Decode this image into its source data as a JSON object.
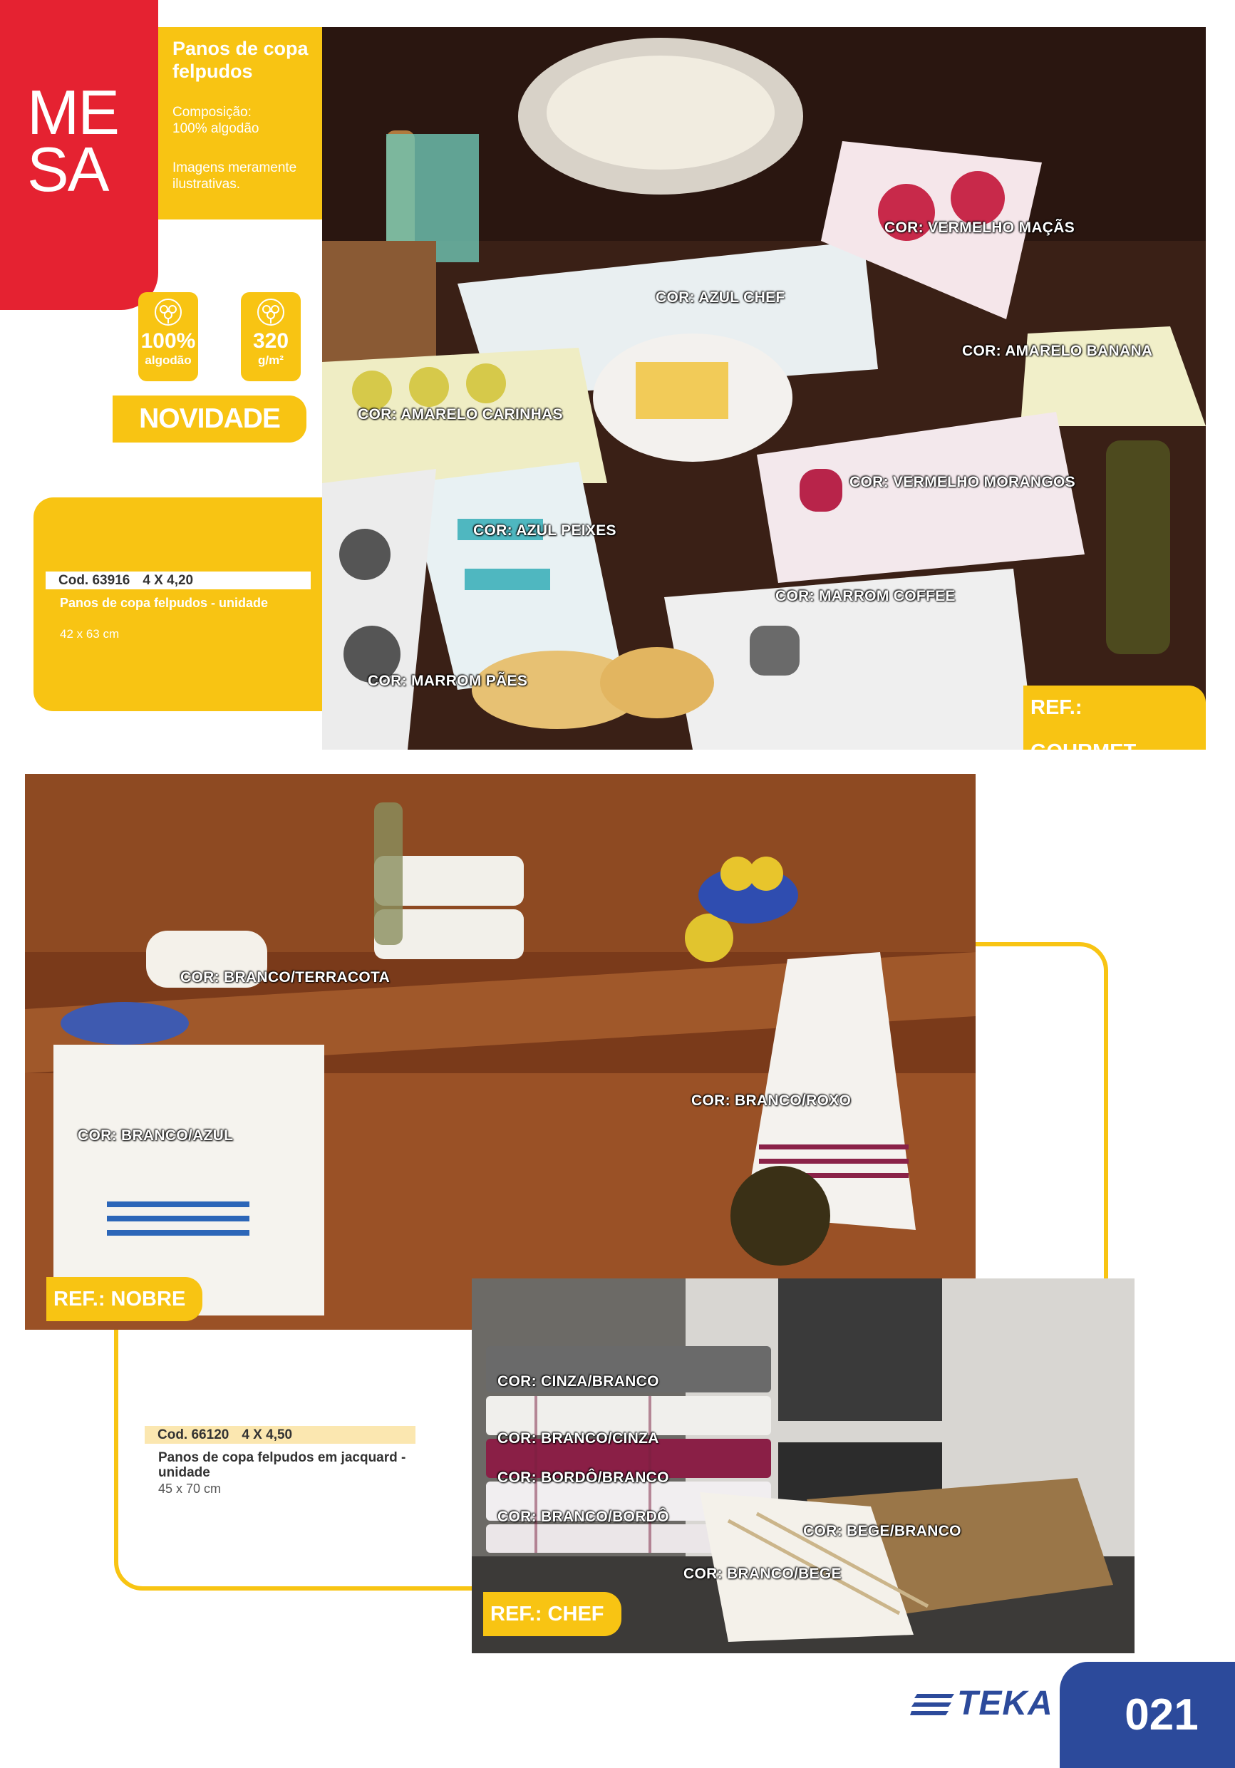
{
  "section": {
    "title": "ME\nSA",
    "color": "#e52231"
  },
  "info": {
    "title": "Panos de copa felpudos",
    "composition": "Composição:\n100% algodão",
    "disclaimer": "Imagens meramente\nilustrativas."
  },
  "badges": [
    {
      "value": "100%",
      "unit": "algodão",
      "icon": "cotton-flower-icon"
    },
    {
      "value": "320",
      "unit": "g/m²",
      "icon": "cotton-flower-icon"
    }
  ],
  "novidade": "NOVIDADE",
  "product1": {
    "code": "Cod. 63916",
    "pack": "4 X 4,20",
    "name": "Panos de copa felpudos - unidade",
    "size": "42 x 63 cm"
  },
  "photo1": {
    "ref": "REF.: GOURMET",
    "colors": [
      "COR: VERMELHO MAÇÃS",
      "COR: AZUL CHEF",
      "COR: AMARELO BANANA",
      "COR: AMARELO CARINHAS",
      "COR: VERMELHO MORANGOS",
      "COR: AZUL PEIXES",
      "COR: MARROM COFFEE",
      "COR: MARROM PÃES"
    ]
  },
  "photo2": {
    "ref": "REF.: NOBRE",
    "colors": [
      "COR: BRANCO/TERRACOTA",
      "COR: BRANCO/ROXO",
      "COR: BRANCO/AZUL"
    ]
  },
  "product2": {
    "code": "Cod. 66120",
    "pack": "4 X 4,50",
    "name": "Panos de copa felpudos em jacquard - unidade",
    "size": "45 x 70 cm"
  },
  "photo3": {
    "ref": "REF.: CHEF",
    "colors": [
      "COR: CINZA/BRANCO",
      "COR: BRANCO/CINZA",
      "COR: BORDÔ/BRANCO",
      "COR: BRANCO/BORDÔ",
      "COR: BEGE/BRANCO",
      "COR: BRANCO/BEGE"
    ]
  },
  "footer": {
    "brand": "TEKA",
    "page": "021"
  },
  "colors": {
    "accent": "#f8c413",
    "brand": "#2c4a9b",
    "red": "#e52231"
  }
}
